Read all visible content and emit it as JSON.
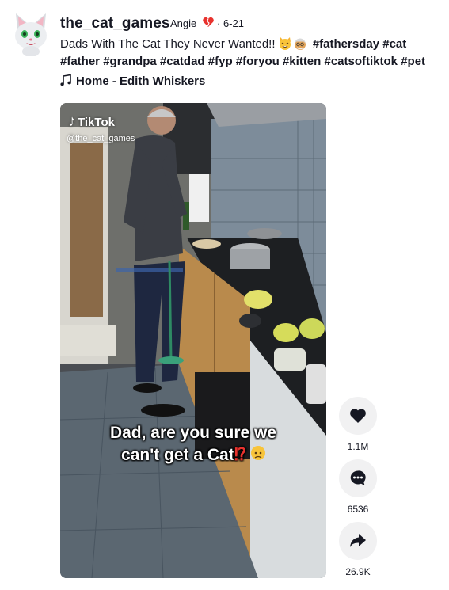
{
  "post": {
    "username": "the_cat_games",
    "nickname": "Angie",
    "date": "· 6-21",
    "caption_text": "Dads With The Cat They Never Wanted!! ",
    "hashtags_line1": [
      "#fathersday",
      "#cat"
    ],
    "hashtags_line2": [
      "#father",
      "#grandpa",
      "#catdad",
      "#fyp",
      "#foryou",
      "#kitten",
      "#catsoftiktok",
      "#pet"
    ],
    "music": "Home - Edith Whiskers"
  },
  "video": {
    "watermark_brand": "TikTok",
    "watermark_user": "@the_cat_games",
    "subtitle_line1": "Dad, are you sure we",
    "subtitle_line2": "can't get a Cat",
    "subtitle_mark": "⁉"
  },
  "actions": {
    "likes": "1.1M",
    "comments": "6536",
    "shares": "26.9K"
  },
  "colors": {
    "text": "#161823",
    "action_bg": "#f1f1f2",
    "heart_emoji": "#e8322e"
  }
}
